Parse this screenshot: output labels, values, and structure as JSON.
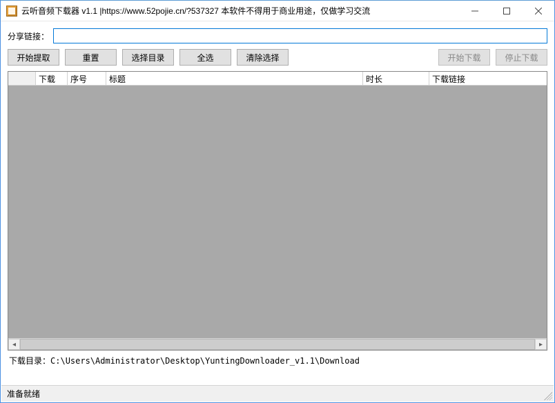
{
  "titlebar": {
    "title": "云听音频下载器 v1.1 |https://www.52pojie.cn/?537327 本软件不得用于商业用途，仅做学习交流"
  },
  "share": {
    "label": "分享链接：",
    "value": ""
  },
  "buttons": {
    "extract": "开始提取",
    "reset": "重置",
    "choose_dir": "选择目录",
    "select_all": "全选",
    "clear_sel": "清除选择",
    "start_dl": "开始下载",
    "stop_dl": "停止下载"
  },
  "grid": {
    "columns": {
      "rowhdr": "",
      "download": "下载",
      "index": "序号",
      "title": "标题",
      "duration": "时长",
      "link": "下载链接"
    },
    "rows": []
  },
  "path": {
    "label": "下载目录：",
    "value": "C:\\Users\\Administrator\\Desktop\\YuntingDownloader_v1.1\\Download"
  },
  "status": {
    "text": "准备就绪"
  }
}
